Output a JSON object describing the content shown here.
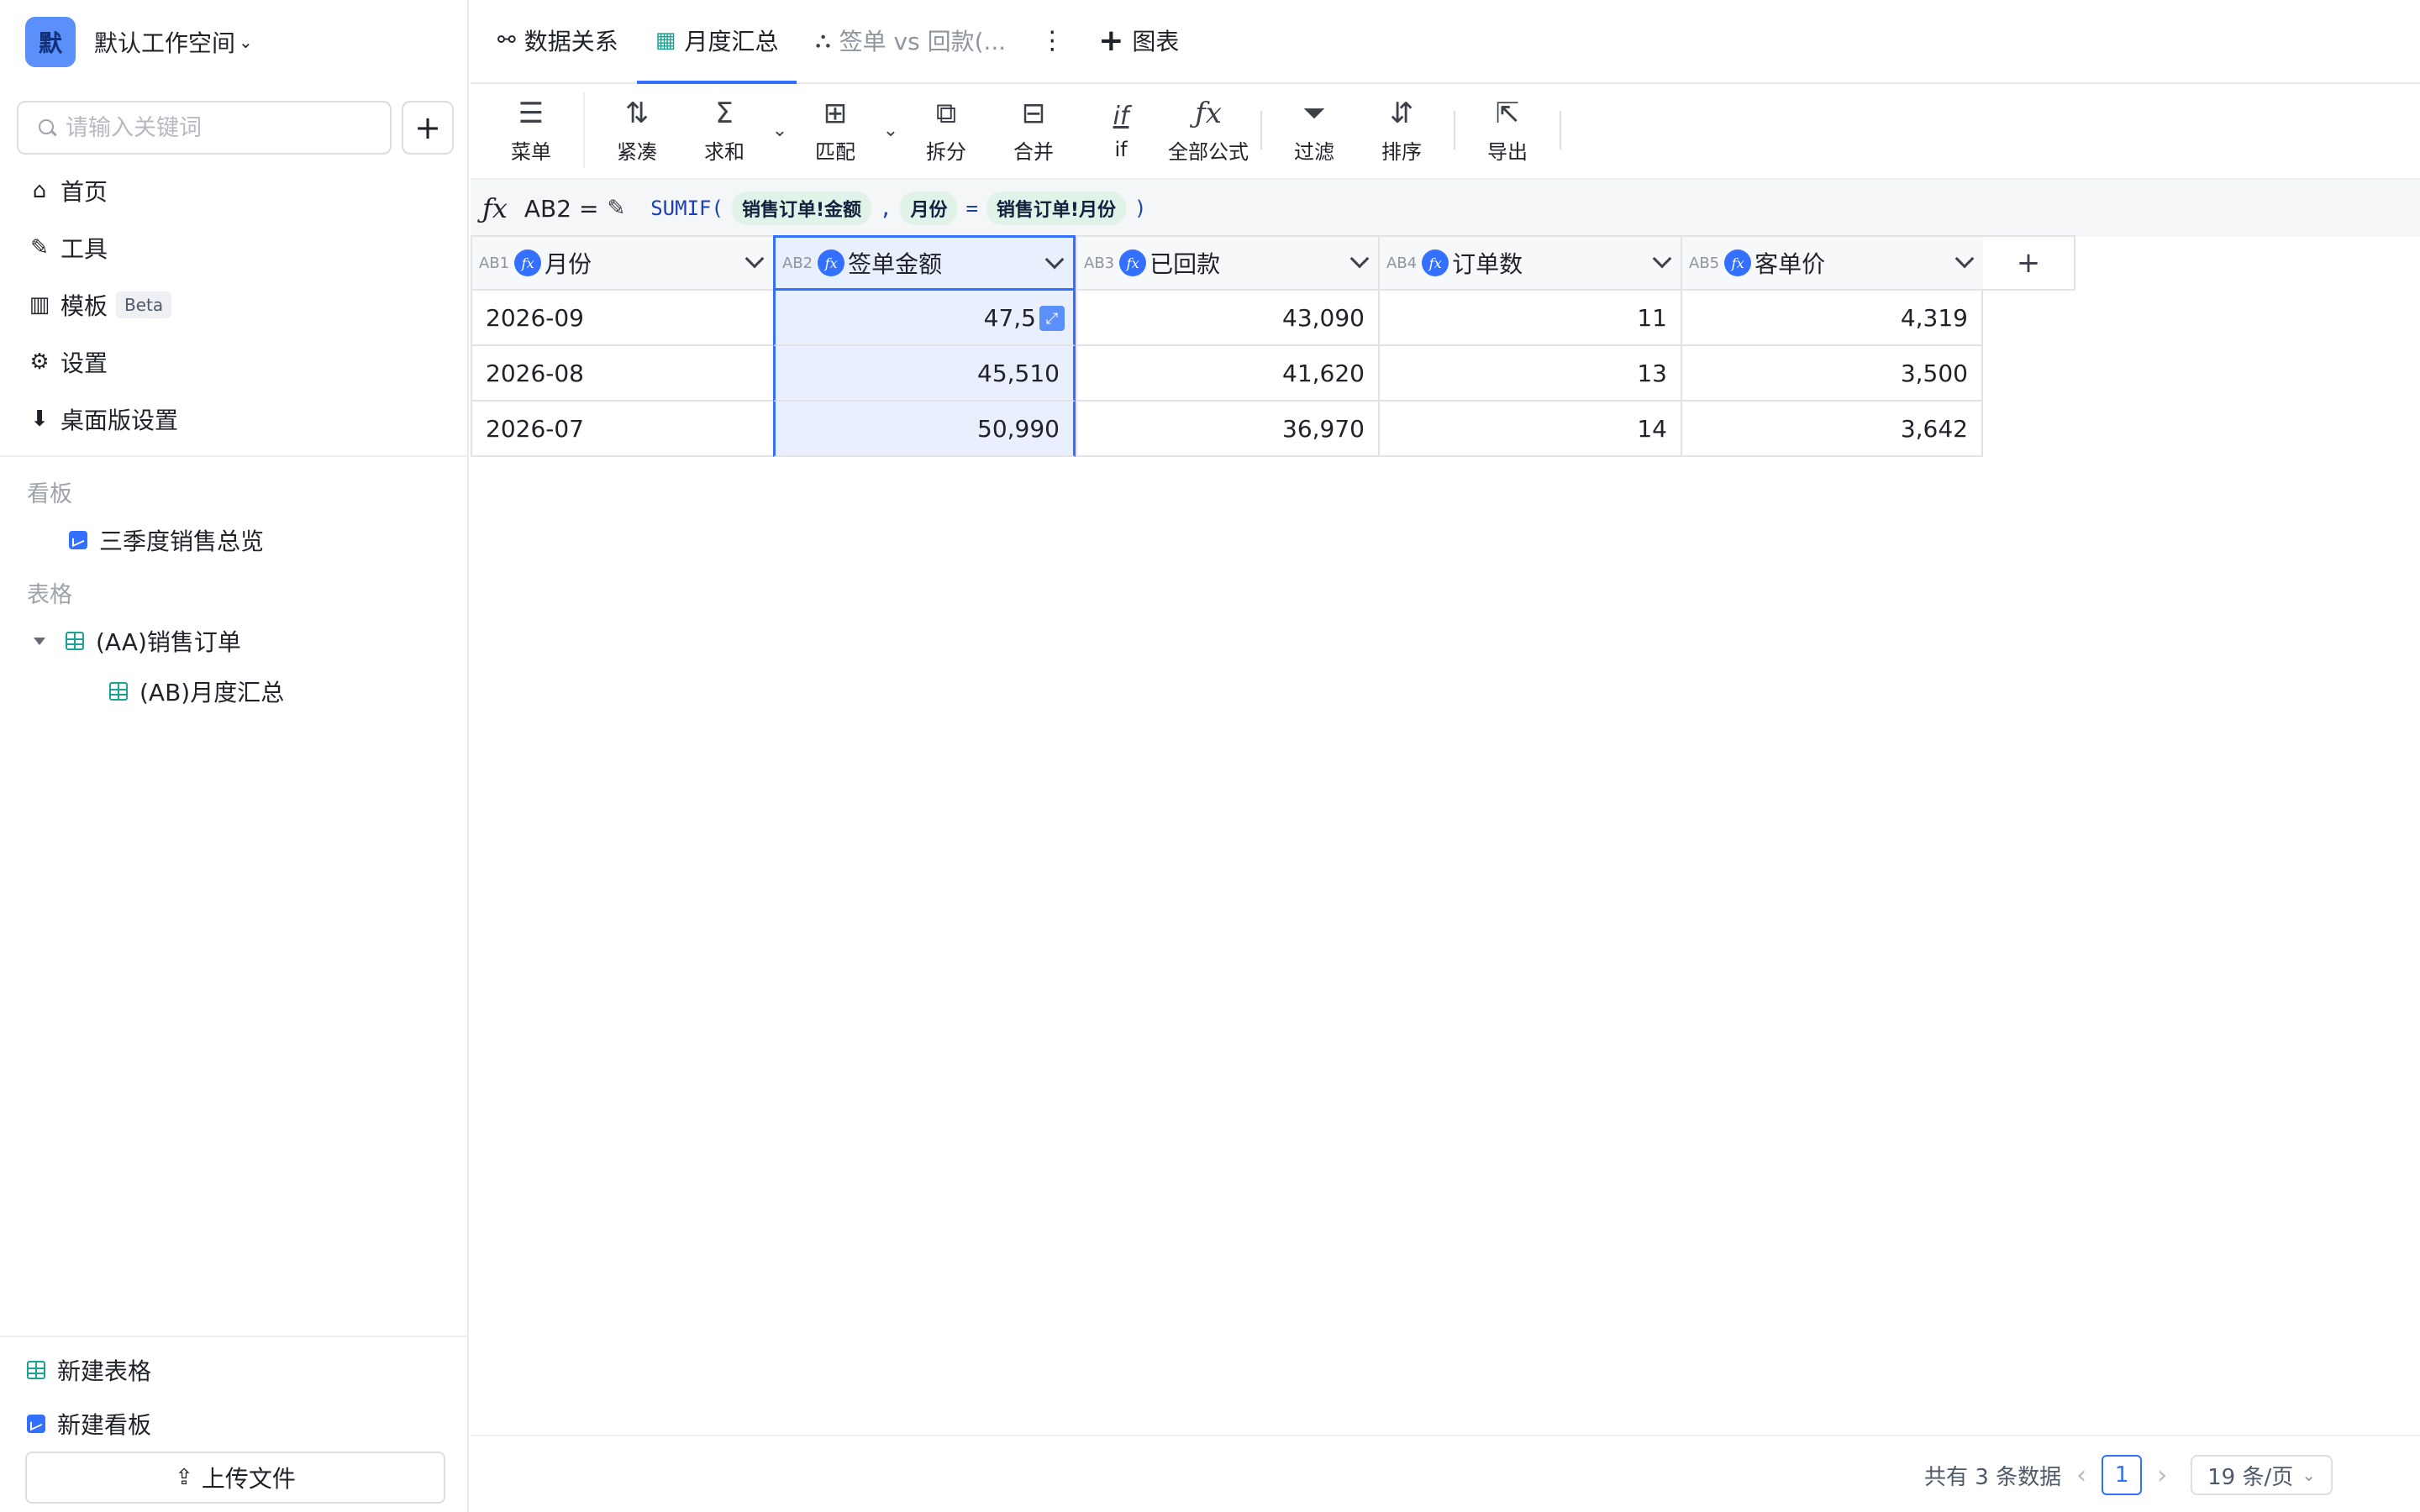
{
  "workspace": {
    "avatar": "默",
    "name": "默认工作空间",
    "chevron": "⌄"
  },
  "search": {
    "placeholder": "请输入关键词",
    "add_label": "+"
  },
  "nav": [
    {
      "label": "首页",
      "icon": "home-icon",
      "glyph": "⌂"
    },
    {
      "label": "工具",
      "icon": "wrench-icon",
      "glyph": "✎"
    },
    {
      "label": "模板",
      "icon": "template-icon",
      "glyph": "▥",
      "badge": "Beta"
    },
    {
      "label": "设置",
      "icon": "gear-icon",
      "glyph": "⚙"
    },
    {
      "label": "桌面版设置",
      "icon": "desktop-settings-icon",
      "glyph": "⬇"
    }
  ],
  "sections": {
    "dashboards_label": "看板",
    "dashboards": [
      {
        "label": "三季度销售总览"
      }
    ],
    "tables_label": "表格",
    "tables": [
      {
        "label": "(AA)销售订单"
      },
      {
        "label": "(AB)月度汇总"
      }
    ]
  },
  "sidebar_bottom": {
    "new_table": "新建表格",
    "new_dashboard": "新建看板",
    "upload": "上传文件"
  },
  "tabs": [
    {
      "label": "数据关系",
      "icon": "share-icon",
      "glyph": "⚯"
    },
    {
      "label": "月度汇总",
      "icon": "table-icon",
      "glyph": "▦",
      "active": true
    },
    {
      "label": "签单 vs 回款(...",
      "icon": "chart-icon",
      "glyph": "⛬"
    }
  ],
  "tab_more_glyph": "⋮",
  "add_chart_label": "图表",
  "toolbar": [
    {
      "label": "菜单",
      "icon": "menu-icon",
      "glyph": "☰"
    },
    {
      "label": "紧凑",
      "icon": "compact-icon",
      "glyph": "⇅"
    },
    {
      "label": "求和",
      "icon": "sum-icon",
      "glyph": "Σ",
      "dropdown": true
    },
    {
      "label": "匹配",
      "icon": "match-icon",
      "glyph": "⊞",
      "dropdown": true
    },
    {
      "label": "拆分",
      "icon": "split-icon",
      "glyph": "⧉"
    },
    {
      "label": "合并",
      "icon": "merge-icon",
      "glyph": "⊟"
    },
    {
      "label": "if",
      "icon": "if-icon",
      "glyph": "if"
    },
    {
      "label": "全部公式",
      "icon": "fx-icon",
      "glyph": "ƒx"
    },
    {
      "label": "过滤",
      "icon": "filter-icon",
      "glyph": "⏷"
    },
    {
      "label": "排序",
      "icon": "sort-icon",
      "glyph": "⇵"
    },
    {
      "label": "导出",
      "icon": "export-icon",
      "glyph": "⇱"
    }
  ],
  "formula_bar": {
    "fx": "ƒx",
    "cell_ref": "AB2 =",
    "func_open": "SUMIF(",
    "arg1": "销售订单!金额",
    "comma": ",",
    "arg2": "月份",
    "eq": "=",
    "arg3": "销售订单!月份",
    "close": ")"
  },
  "columns": [
    {
      "id": "AB1",
      "name": "月份"
    },
    {
      "id": "AB2",
      "name": "签单金额",
      "selected": true
    },
    {
      "id": "AB3",
      "name": "已回款"
    },
    {
      "id": "AB4",
      "name": "订单数"
    },
    {
      "id": "AB5",
      "name": "客单价"
    }
  ],
  "rows": [
    [
      "2026-09",
      "47,510",
      "43,090",
      "11",
      "4,319"
    ],
    [
      "2026-08",
      "45,510",
      "41,620",
      "13",
      "3,500"
    ],
    [
      "2026-07",
      "50,990",
      "36,970",
      "14",
      "3,642"
    ]
  ],
  "active_cell_display": "47,5",
  "footer": {
    "total": "共有 3 条数据",
    "page": "1",
    "page_size": "19 条/页"
  },
  "colors": {
    "accent": "#3370ff",
    "selected_bg": "#e9effd",
    "pill_bg": "#e1f3e9"
  }
}
